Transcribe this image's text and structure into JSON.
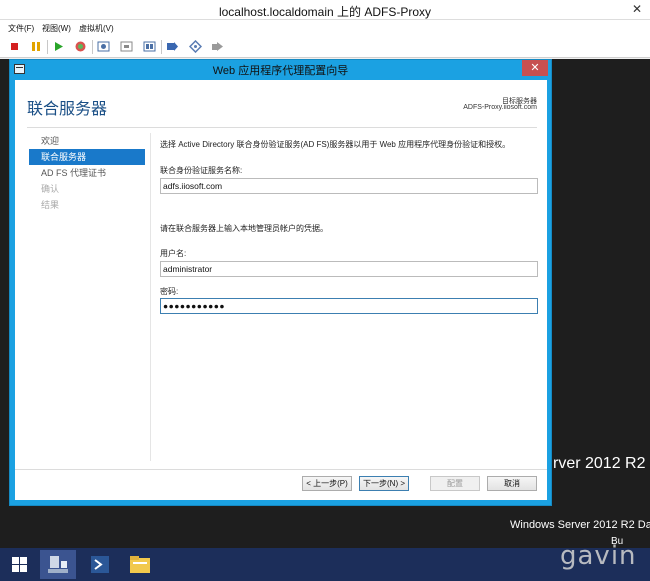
{
  "vm": {
    "title": "localhost.localdomain 上的 ADFS-Proxy",
    "close_glyph": "✕",
    "menus": [
      "文件(F)",
      "视图(W)",
      "虚拟机(V)"
    ]
  },
  "wizard": {
    "title": "Web 应用程序代理配置向导",
    "close_glyph": "✕",
    "heading": "联合服务器",
    "destination_label": "目标服务器",
    "destination_value": "ADFS-Proxy.iiosoft.com",
    "steps": [
      {
        "label": "欢迎",
        "state": "normal"
      },
      {
        "label": "联合服务器",
        "state": "active"
      },
      {
        "label": "AD FS 代理证书",
        "state": "normal"
      },
      {
        "label": "确认",
        "state": "disabled"
      },
      {
        "label": "结果",
        "state": "disabled"
      }
    ],
    "intro": "选择 Active Directory 联合身份验证服务(AD FS)服务器以用于 Web 应用程序代理身份验证和授权。",
    "fs_name_label": "联合身份验证服务名称:",
    "fs_name_value": "adfs.iiosoft.com",
    "credentials_intro": "请在联合服务器上输入本地管理员帐户的凭据。",
    "username_label": "用户名:",
    "username_value": "administrator",
    "password_label": "密码:",
    "password_value": "●●●●●●●●●●●",
    "buttons": {
      "prev": "< 上一步(P)",
      "next": "下一步(N) >",
      "configure": "配置",
      "cancel": "取消"
    }
  },
  "desktop": {
    "brand_text": "rver 2012 R2",
    "edition_text": "Windows Server 2012 R2 Da",
    "build_text": "Bu"
  },
  "watermark": "gavin",
  "colors": {
    "accent": "#1ba1e2",
    "selected_step": "#1979ca",
    "heading": "#1a4f86",
    "taskbar": "#1c2e5a",
    "desktop": "#1e1e1e"
  }
}
